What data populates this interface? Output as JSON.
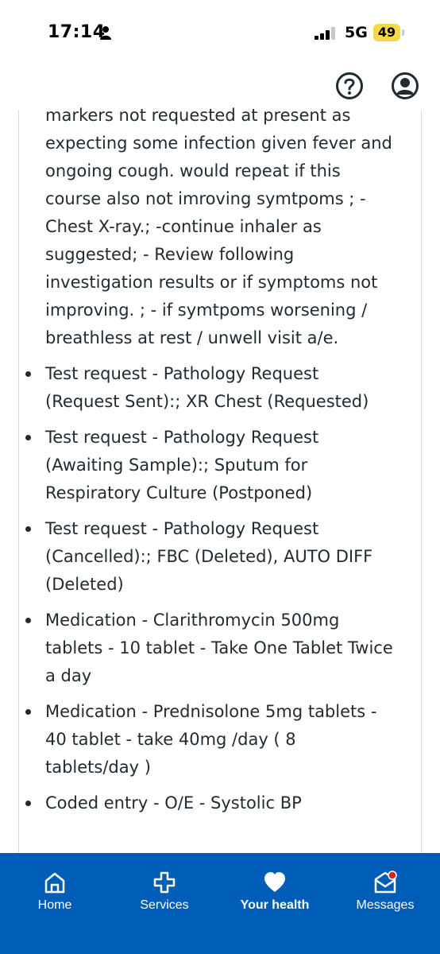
{
  "status_bar": {
    "time": "17:14",
    "network": "5G",
    "battery": "49"
  },
  "header": {
    "help_icon": "help-circle-icon",
    "profile_icon": "user-circle-icon"
  },
  "record": {
    "note_text": "markers not requested at present as expecting some infection given fever and ongoing cough. would repeat if this course also not imroving symtpoms ; - Chest X-ray.; -continue inhaler as suggested; - Review following investigation results or if symptoms not improving. ; - if symtpoms worsening / breathless at rest / unwell visit a/e.",
    "entries": [
      "Test request - Pathology Request (Request Sent):; XR Chest (Requested)",
      "Test request - Pathology Request (Awaiting Sample):; Sputum for Respiratory Culture (Postponed)",
      "Test request - Pathology Request (Cancelled):; FBC (Deleted), AUTO DIFF (Deleted)",
      "Medication - Clarithromycin 500mg tablets - 10 tablet - Take One Tablet Twice a day",
      "Medication - Prednisolone 5mg tablets - 40 tablet - take 40mg /day ( 8 tablets/day )",
      "Coded entry - O/E - Systolic BP"
    ]
  },
  "bottom_nav": {
    "items": [
      {
        "label": "Home",
        "icon": "home-icon",
        "active": false
      },
      {
        "label": "Services",
        "icon": "plus-cross-icon",
        "active": false
      },
      {
        "label": "Your health",
        "icon": "heart-icon",
        "active": true
      },
      {
        "label": "Messages",
        "icon": "envelope-icon",
        "active": false
      }
    ]
  },
  "colors": {
    "nav_background": "#005eb8",
    "text": "#212b32",
    "battery": "#f6d64a",
    "notification_dot": "#d5281b"
  }
}
